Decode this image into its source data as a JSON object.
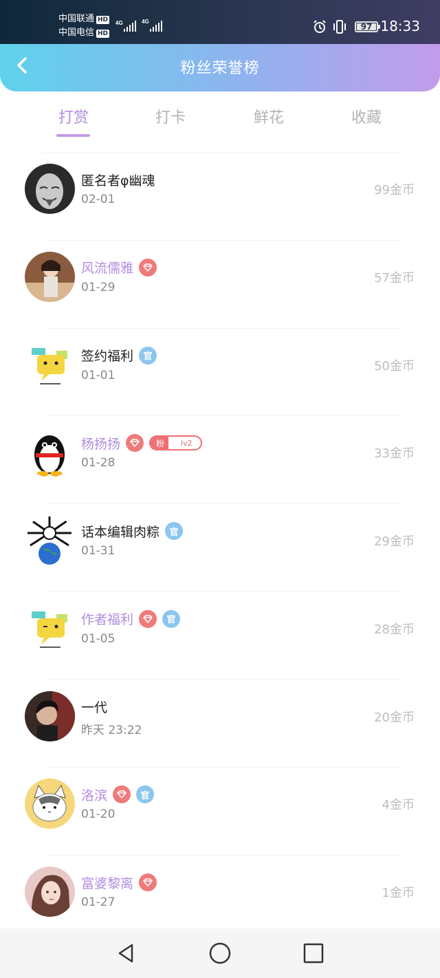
{
  "status_bar": {
    "carrier1": "中国联通",
    "carrier2": "中国电信",
    "hd": "HD",
    "network": "4G",
    "battery": "97",
    "time": "18:33"
  },
  "header": {
    "title": "粉丝荣誉榜"
  },
  "tabs": [
    {
      "label": "打赏",
      "active": true
    },
    {
      "label": "打卡",
      "active": false
    },
    {
      "label": "鲜花",
      "active": false
    },
    {
      "label": "收藏",
      "active": false
    }
  ],
  "badges": {
    "guan": "官",
    "fan_key": "粉",
    "fan_level": "lv2"
  },
  "list": [
    {
      "name": "匿名者φ幽魂",
      "date": "02-01",
      "coins": "99金币",
      "vip": false,
      "guan": false,
      "fan": false
    },
    {
      "name": "风流儒雅",
      "date": "01-29",
      "coins": "57金币",
      "vip": true,
      "guan": false,
      "fan": false
    },
    {
      "name": "签约福利",
      "date": "01-01",
      "coins": "50金币",
      "vip": false,
      "guan": true,
      "fan": false
    },
    {
      "name": "杨扬扬",
      "date": "01-28",
      "coins": "33金币",
      "vip": true,
      "guan": false,
      "fan": true
    },
    {
      "name": "话本编辑肉粽",
      "date": "01-31",
      "coins": "29金币",
      "vip": false,
      "guan": true,
      "fan": false
    },
    {
      "name": "作者福利",
      "date": "01-05",
      "coins": "28金币",
      "vip": true,
      "guan": true,
      "fan": false
    },
    {
      "name": "一代",
      "date": "昨天 23:22",
      "coins": "20金币",
      "vip": false,
      "guan": false,
      "fan": false
    },
    {
      "name": "洛滨",
      "date": "01-20",
      "coins": "4金币",
      "vip": true,
      "guan": true,
      "fan": false
    },
    {
      "name": "富婆黎离",
      "date": "01-27",
      "coins": "1金币",
      "vip": true,
      "guan": false,
      "fan": false
    }
  ],
  "colors": {
    "accent": "#b28de0",
    "vip_badge": "#f07a7a",
    "guan_badge": "#8cc6ee"
  }
}
